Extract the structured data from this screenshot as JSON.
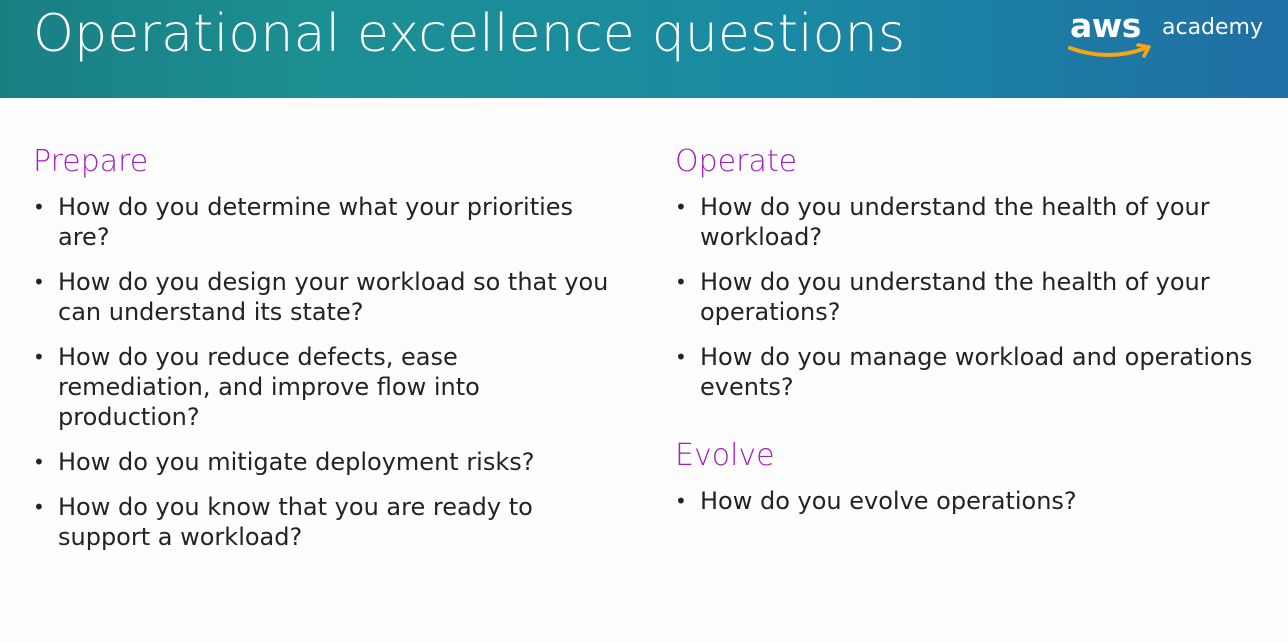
{
  "header": {
    "title": "Operational excellence questions",
    "logo": {
      "brand": "aws",
      "sub": "academy",
      "smile_color": "#f7a41d"
    }
  },
  "colors": {
    "heading": "#a020c0",
    "body_text": "#232323",
    "header_gradient_start": "#1a7f84",
    "header_gradient_end": "#1f6fa5"
  },
  "sections": {
    "prepare": {
      "heading": "Prepare",
      "questions": [
        "How do you determine what your priorities are?",
        "How do you design your workload so that you can understand its state?",
        "How do you reduce defects, ease remediation, and improve flow into production?",
        "How do you mitigate deployment risks?",
        "How do you know that you are ready to support a workload?"
      ]
    },
    "operate": {
      "heading": "Operate",
      "questions": [
        "How do you understand the health of your workload?",
        "How do you understand the health of your operations?",
        "How do you manage workload and operations events?"
      ]
    },
    "evolve": {
      "heading": "Evolve",
      "questions": [
        "How do you evolve operations?"
      ]
    }
  }
}
